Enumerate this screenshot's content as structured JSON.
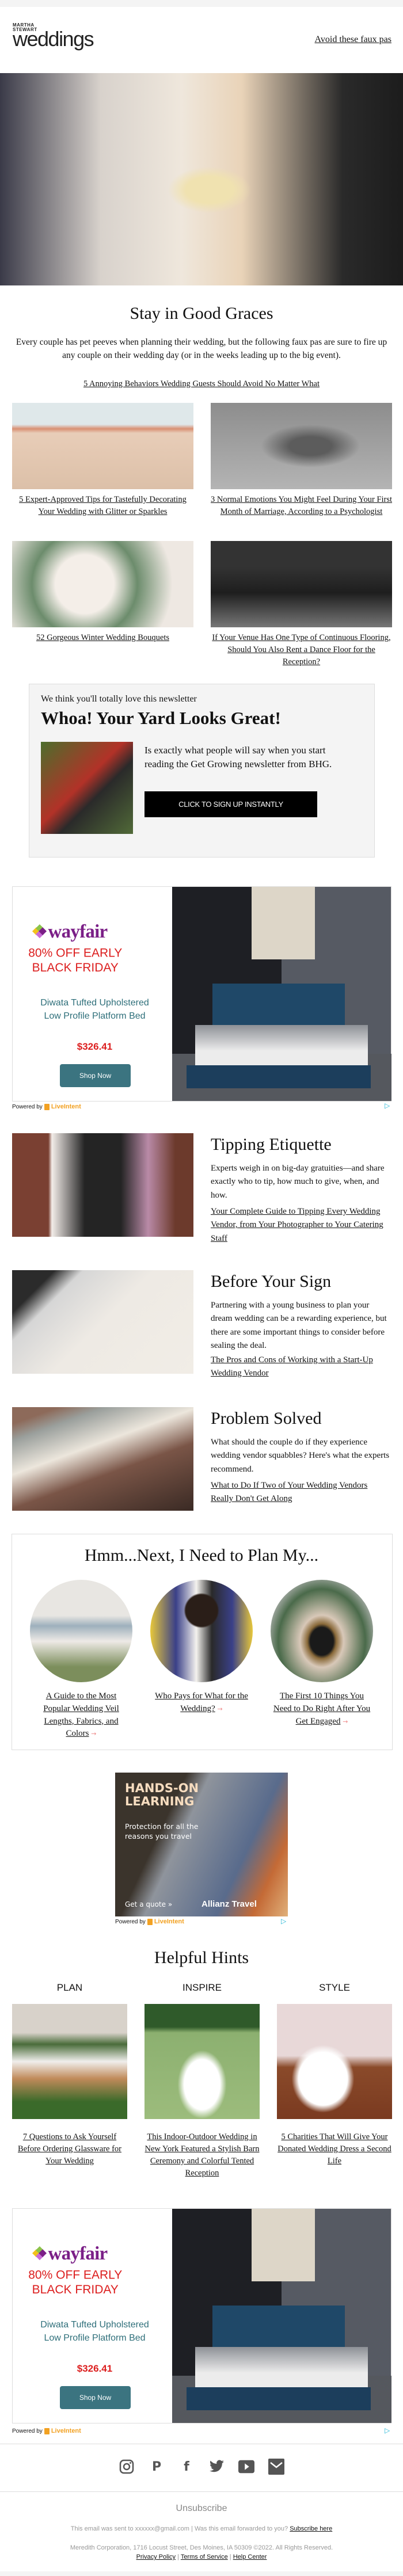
{
  "header": {
    "logo_line1": "MARTHA",
    "logo_line2": "STEWART",
    "logo_word": "weddings",
    "link": "Avoid these faux pas"
  },
  "intro": {
    "title": "Stay in Good Graces",
    "body": "Every couple has pet peeves when planning their wedding, but the following faux pas are sure to fire up any couple on their wedding day (or in the weeks leading up to the big event).",
    "link": "5 Annoying Behaviors Wedding Guests Should Avoid No Matter What"
  },
  "grid": [
    {
      "caption": "5 Expert-Approved Tips for Tastefully Decorating Your Wedding with Glitter or Sparkles"
    },
    {
      "caption": "3 Normal Emotions You Might Feel During Your First Month of Marriage, According to a Psychologist"
    },
    {
      "caption": "52 Gorgeous Winter Wedding Bouquets"
    },
    {
      "caption": "If Your Venue Has One Type of Continuous Flooring, Should You Also Rent a Dance Floor for the Reception?"
    }
  ],
  "newsletter": {
    "pre": "We think you'll totally love this newsletter",
    "title": "Whoa! Your Yard Looks Great!",
    "body": "Is exactly what people will say when you start reading the Get Growing newsletter from BHG.",
    "button": "CLICK TO SIGN UP INSTANTLY"
  },
  "wayfair_ad": {
    "brand": "wayfair",
    "deal_line1": "80% OFF EARLY",
    "deal_line2": "BLACK FRIDAY",
    "product_line1": "Diwata Tufted Upholstered",
    "product_line2": "Low Profile Platform Bed",
    "price": "$326.41",
    "cta": "Shop Now",
    "powered_by": "Powered by",
    "network": "LiveIntent",
    "colors": {
      "brand": "#7b1f87",
      "deal": "#dc1e1e",
      "product": "#2e6f7a",
      "button": "#3b7480"
    }
  },
  "features": [
    {
      "title": "Tipping Etiquette",
      "body": "Experts weigh in on big-day gratuities—and share exactly who to tip, how much to give, when, and how.",
      "link": "Your Complete Guide to Tipping Every Wedding Vendor, from Your Photographer to Your Catering Staff"
    },
    {
      "title": "Before Your Sign",
      "body": "Partnering with a young business to plan your dream wedding can be a rewarding experience, but there are some important things to consider before sealing the deal.",
      "link": "The Pros and Cons of Working with a Start-Up Wedding Vendor"
    },
    {
      "title": "Problem Solved",
      "body": "What should the couple do if they experience wedding vendor squabbles? Here's what the experts recommend.",
      "link": "What to Do If Two of Your Wedding Vendors Really Don't Get Along"
    }
  ],
  "plan": {
    "title": "Hmm...Next, I Need to Plan My...",
    "items": [
      {
        "caption": "A Guide to the Most Popular Wedding Veil Lengths, Fabrics, and Colors"
      },
      {
        "caption": "Who Pays for What for the Wedding?"
      },
      {
        "caption": "The First 10 Things You Need to Do Right After You Get Engaged"
      }
    ],
    "arrow_icon": "arrow-right-icon"
  },
  "allianz_ad": {
    "headline_line1": "HANDS-ON",
    "headline_line2": "LEARNING",
    "sub": "Protection for all the reasons you travel",
    "cta": "Get a quote »",
    "brand": "Allianz Travel",
    "powered_by": "Powered by",
    "network": "LiveIntent"
  },
  "hints": {
    "title": "Helpful Hints",
    "columns": [
      {
        "label": "PLAN",
        "caption": "7 Questions to Ask Yourself Before Ordering Glassware for Your Wedding"
      },
      {
        "label": "INSPIRE",
        "caption": "This Indoor-Outdoor Wedding in New York Featured a Stylish Barn Ceremony and Colorful Tented Reception"
      },
      {
        "label": "STYLE",
        "caption": "5 Charities That Will Give Your Donated Wedding Dress a Second Life"
      }
    ]
  },
  "footer": {
    "social": [
      "instagram-icon",
      "pinterest-icon",
      "facebook-icon",
      "twitter-icon",
      "youtube-icon",
      "email-icon"
    ],
    "unsubscribe": "Unsubscribe",
    "sent_to": "This email was sent to xxxxxx@gmail.com",
    "forwarded": "Was this email forwarded to you?",
    "subscribe": "Subscribe here",
    "address": "Meredith Corporation, 1716 Locust Street, Des Moines, IA 50309 ©2022. All Rights Reserved.",
    "links": [
      "Privacy Policy",
      "Terms of Service",
      "Help Center"
    ],
    "separator": "|"
  }
}
